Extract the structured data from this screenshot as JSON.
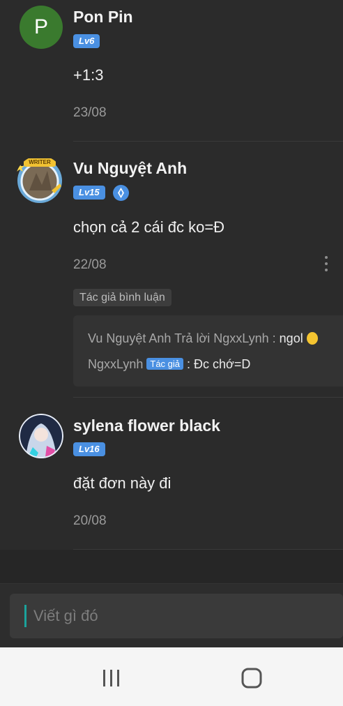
{
  "comments": [
    {
      "name": "Pon Pin",
      "avatar_letter": "P",
      "level": "Lv6",
      "content": "+1:3",
      "date": "23/08"
    },
    {
      "name": "Vu Nguyệt Anh",
      "avatar_badge": "WRITER",
      "level": "Lv15",
      "content": "chọn cả 2 cái đc ko=Đ",
      "date": "22/08",
      "tag": "Tác giả bình luận",
      "replies": [
        {
          "user": "Vu Nguyệt Anh",
          "action": "Trả lời",
          "target": "NgxxLynh :",
          "text": "ngol"
        },
        {
          "user": "NgxxLynh",
          "author_tag": "Tác giả",
          "text": ": Đc chớ=D"
        }
      ]
    },
    {
      "name": "sylena flower black",
      "level": "Lv16",
      "content": "đặt đơn này đi",
      "date": "20/08"
    }
  ],
  "composer": {
    "placeholder": "Viết gì đó"
  },
  "colors": {
    "accent_blue": "#4a90e2",
    "background": "#2b2b2b",
    "avatar_green": "#3a7a2e",
    "caret_teal": "#1ba39c"
  },
  "icons": {
    "verified": "diamond-badge-icon",
    "more": "kebab-menu-icon",
    "recent_apps": "recent-apps-icon",
    "home": "home-icon",
    "emoji": "emoji-icon"
  }
}
